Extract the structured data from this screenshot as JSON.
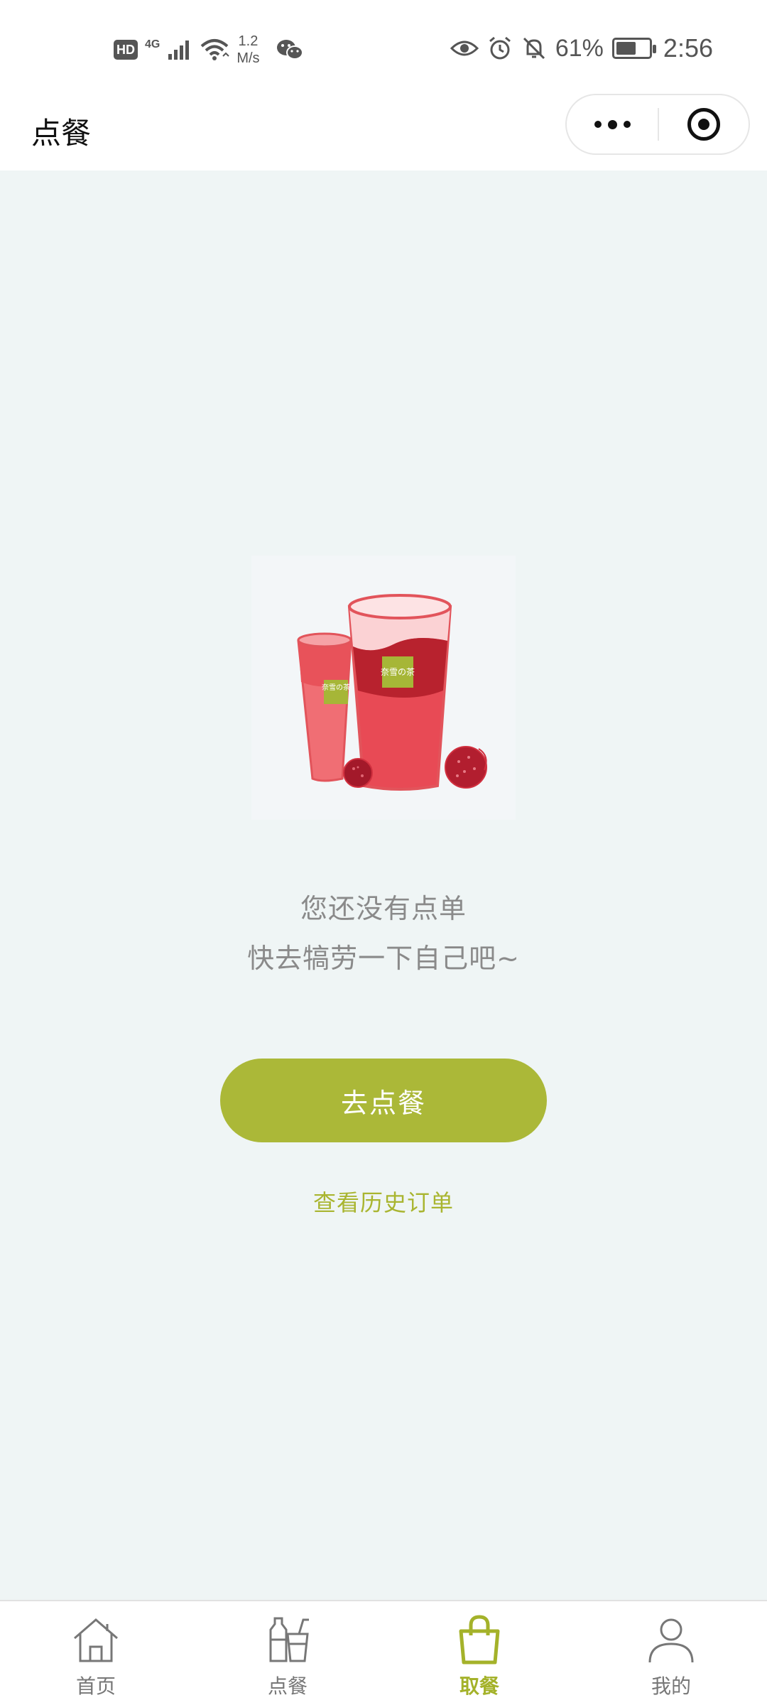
{
  "status_bar": {
    "hd": "HD",
    "network": "4G",
    "speed_value": "1.2",
    "speed_unit": "M/s",
    "battery_percent": "61%",
    "battery_level": 0.61,
    "time": "2:56"
  },
  "header": {
    "title": "点餐"
  },
  "empty_state": {
    "line1": "您还没有点单",
    "line2": "快去犒劳一下自己吧~",
    "primary_button": "去点餐",
    "history_link": "查看历史订单"
  },
  "illustration": {
    "brand_logo_text": "奈雪の茶"
  },
  "tabs": [
    {
      "label": "首页",
      "icon": "home-icon",
      "active": false
    },
    {
      "label": "点餐",
      "icon": "drinks-icon",
      "active": false
    },
    {
      "label": "取餐",
      "icon": "bag-icon",
      "active": true
    },
    {
      "label": "我的",
      "icon": "profile-icon",
      "active": false
    }
  ],
  "colors": {
    "accent": "#abb838",
    "background": "#eff5f5",
    "muted_text": "#8a8a8a"
  }
}
